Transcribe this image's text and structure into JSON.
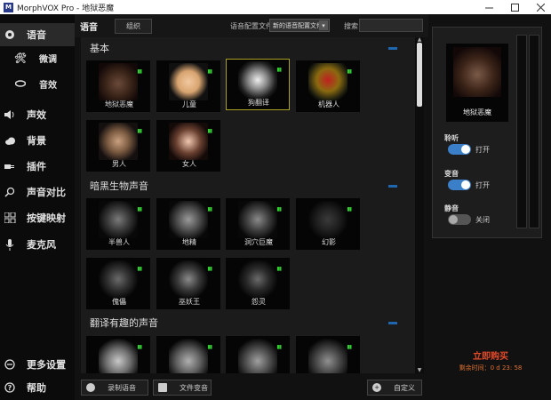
{
  "window": {
    "title": "MorphVOX Pro - 地狱恶魔",
    "logo": "M",
    "min_icon": "minimize-icon",
    "max_icon": "maximize-icon",
    "close_icon": "close-icon"
  },
  "sidebar": {
    "items": [
      {
        "label": "语音",
        "icon": "voice-icon",
        "active": true
      },
      {
        "label": "微调",
        "icon": "tools-icon"
      },
      {
        "label": "音效",
        "icon": "lips-icon"
      },
      {
        "label": "声效",
        "icon": "speaker-icon"
      },
      {
        "label": "背景",
        "icon": "cloud-icon"
      },
      {
        "label": "插件",
        "icon": "plug-icon"
      },
      {
        "label": "声音对比",
        "icon": "magnifier-icon"
      },
      {
        "label": "按键映射",
        "icon": "keys-icon"
      },
      {
        "label": "麦克风",
        "icon": "mic-icon"
      },
      {
        "label": "更多设置",
        "icon": "more-icon"
      },
      {
        "label": "帮助",
        "icon": "help-icon"
      }
    ]
  },
  "header": {
    "title": "语音",
    "group_button": "组织",
    "profile_label": "语音配置文件",
    "profile_value": "新的语音配置文件",
    "search_label": "搜索",
    "search_value": ""
  },
  "categories": [
    {
      "title": "基本",
      "voices": [
        "地狱恶魔",
        "儿童",
        "狗翻译",
        "机器人",
        "男人",
        "女人"
      ]
    },
    {
      "title": "暗黑生物声音",
      "voices": [
        "半兽人",
        "地精",
        "洞穴巨魔",
        "幻影",
        "傀儡",
        "巫妖王",
        "怨灵"
      ]
    },
    {
      "title": "翻译有趣的声音",
      "voices": [
        "",
        "",
        "",
        ""
      ]
    }
  ],
  "selected_voice": "狗翻译",
  "bottom_buttons": {
    "record": "录制语音",
    "file": "文件变音",
    "custom": "自定义"
  },
  "right_panel": {
    "current_voice": "地狱恶魔",
    "listen_label": "聆听",
    "listen_state": "打开",
    "morph_label": "变音",
    "morph_state": "打开",
    "mute_label": "静音",
    "mute_state": "关闭"
  },
  "promo": {
    "buy": "立即购买",
    "timer": "剩余时间：0 d 23: 58"
  },
  "colors": {
    "accent": "#1e66b0",
    "selected_border": "#a8a020",
    "buy": "#e14a2a",
    "signal": "#33cc33"
  }
}
